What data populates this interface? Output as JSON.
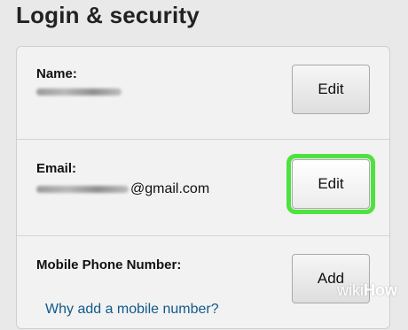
{
  "page": {
    "title": "Login & security"
  },
  "rows": [
    {
      "label": "Name:",
      "value_suffix": "",
      "button": "Edit",
      "link": ""
    },
    {
      "label": "Email:",
      "value_suffix": "@gmail.com",
      "button": "Edit",
      "link": ""
    },
    {
      "label": "Mobile Phone Number:",
      "value_suffix": "",
      "button": "Add",
      "link": "Why add a mobile number?"
    }
  ],
  "watermark": {
    "wiki": "wiki",
    "how": "How"
  },
  "colors": {
    "highlight": "#4fe23f",
    "link": "#0f5a8a",
    "background": "#e9e9e9"
  }
}
